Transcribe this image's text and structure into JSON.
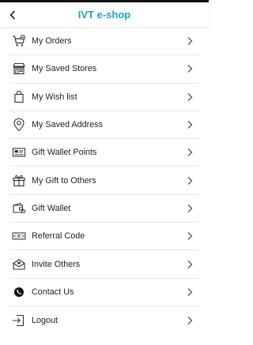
{
  "header": {
    "title": "IVT e-shop"
  },
  "menu": {
    "items": [
      {
        "label": "My Orders",
        "icon": "cart-icon"
      },
      {
        "label": "My Saved Stores",
        "icon": "store-icon"
      },
      {
        "label": "My Wish list",
        "icon": "bag-icon"
      },
      {
        "label": "My Saved Address",
        "icon": "location-pin-icon"
      },
      {
        "label": "Gift Wallet Points",
        "icon": "points-card-icon"
      },
      {
        "label": "My Gift to Others",
        "icon": "gift-icon"
      },
      {
        "label": "Gift Wallet",
        "icon": "wallet-icon"
      },
      {
        "label": "Referral Code",
        "icon": "ticket-icon"
      },
      {
        "label": "Invite Others",
        "icon": "envelope-icon"
      },
      {
        "label": "Contact Us",
        "icon": "phone-icon"
      },
      {
        "label": "Logout",
        "icon": "logout-icon"
      }
    ]
  },
  "colors": {
    "accent": "#1aa3c7",
    "text": "#222222",
    "divider": "#e6e6e6"
  }
}
